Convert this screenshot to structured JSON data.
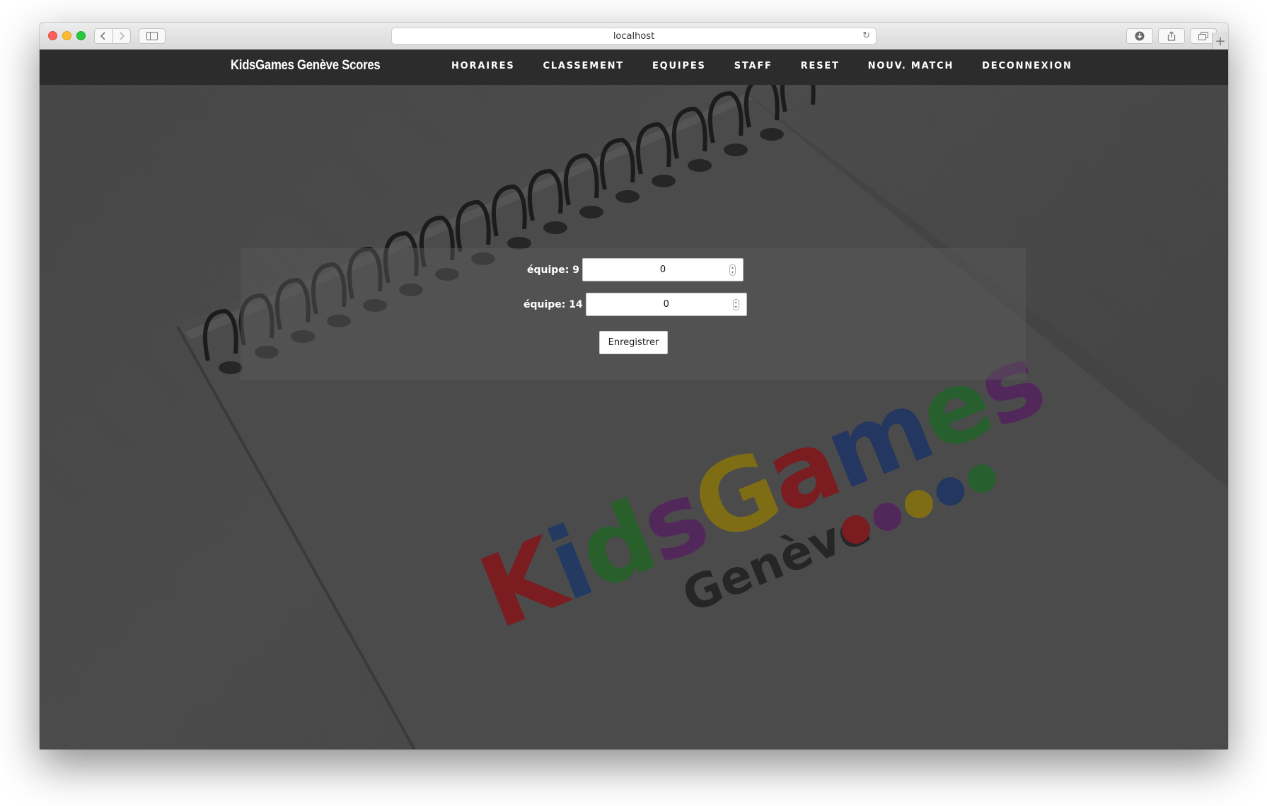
{
  "browser": {
    "url": "localhost"
  },
  "navbar": {
    "brand": "KidsGames Genève Scores",
    "items": [
      {
        "label": "HORAIRES"
      },
      {
        "label": "CLASSEMENT"
      },
      {
        "label": "EQUIPES"
      },
      {
        "label": "STAFF"
      },
      {
        "label": "RESET"
      },
      {
        "label": "NOUV. MATCH"
      },
      {
        "label": "DECONNEXION"
      }
    ]
  },
  "form": {
    "team1_label": "équipe: 9",
    "team1_score": "0",
    "team2_label": "équipe: 14",
    "team2_score": "0",
    "submit_label": "Enregistrer"
  },
  "background_logo": {
    "text": "KidsGames",
    "subtitle": "Genève",
    "colors": [
      "#8a1e22",
      "#243a63",
      "#2c6a2e",
      "#5b2a62",
      "#8c7a18",
      "#2a3a60",
      "#2b5e35"
    ]
  }
}
